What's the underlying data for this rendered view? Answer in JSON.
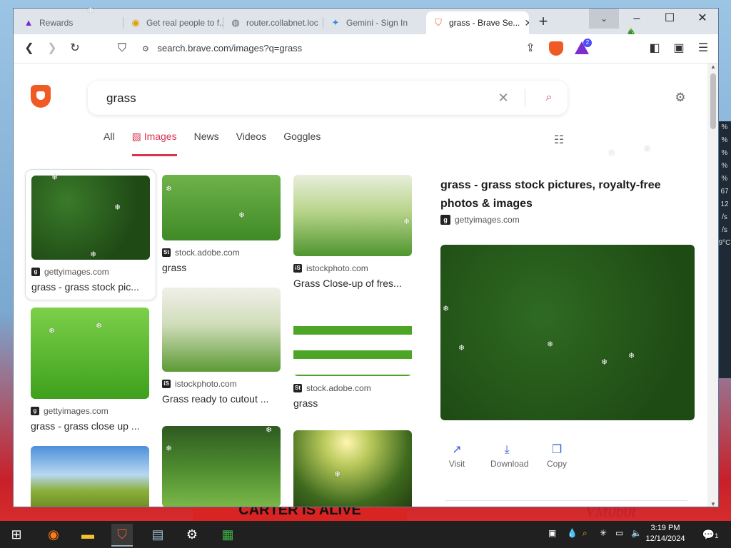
{
  "desktop": {
    "banner": "CARTER IS ALIVE",
    "signature": "VM0b0t",
    "side_values": [
      "%",
      "%",
      "%",
      "%",
      "%",
      "67",
      "12",
      "/s",
      "/s",
      "9°C"
    ]
  },
  "browser": {
    "tabs": [
      {
        "label": "Rewards",
        "active": false
      },
      {
        "label": "Get real people to f...",
        "active": false
      },
      {
        "label": "router.collabnet.loc",
        "active": false
      },
      {
        "label": "Gemini - Sign In",
        "active": false
      },
      {
        "label": "grass - Brave Se...",
        "active": true
      }
    ],
    "new_tab": "+",
    "url": "search.brave.com/images?q=grass",
    "rewards_badge": "2"
  },
  "search": {
    "query": "grass",
    "nav": [
      "All",
      "Images",
      "News",
      "Videos",
      "Goggles"
    ],
    "active_nav": "Images"
  },
  "results": [
    {
      "source": "gettyimages.com",
      "icon": "g",
      "title": "grass - grass stock pic..."
    },
    {
      "source": "stock.adobe.com",
      "icon": "St",
      "title": "grass"
    },
    {
      "source": "istockphoto.com",
      "icon": "iS",
      "title": "Grass Close-up of fres..."
    },
    {
      "source": "gettyimages.com",
      "icon": "g",
      "title": "grass - grass close up ..."
    },
    {
      "source": "istockphoto.com",
      "icon": "iS",
      "title": "Grass ready to cutout ..."
    },
    {
      "source": "stock.adobe.com",
      "icon": "St",
      "title": "grass"
    }
  ],
  "detail": {
    "title": "grass - grass stock pictures, royalty-free photos & images",
    "source": "gettyimages.com",
    "source_icon": "g",
    "actions": [
      "Visit",
      "Download",
      "Copy"
    ]
  },
  "taskbar": {
    "time": "3:19 PM",
    "date": "12/14/2024",
    "notifications": "1"
  }
}
